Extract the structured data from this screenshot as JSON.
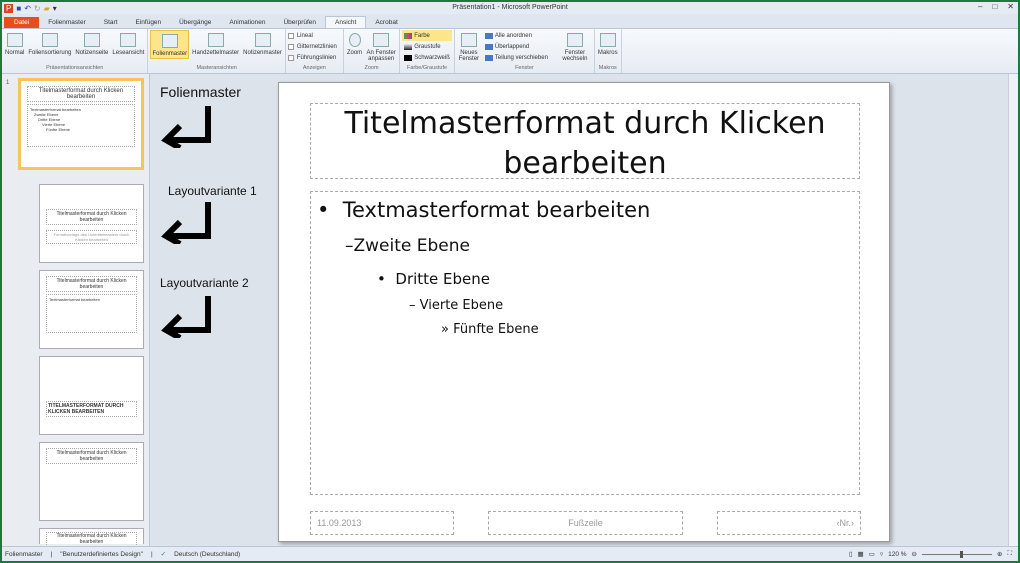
{
  "window": {
    "title": "Präsentation1 - Microsoft PowerPoint"
  },
  "qat": [
    "powerpoint-logo",
    "save-icon",
    "undo-icon",
    "redo-icon",
    "open-icon",
    "customize-icon"
  ],
  "tabs": [
    "Datei",
    "Folienmaster",
    "Start",
    "Einfügen",
    "Übergänge",
    "Animationen",
    "Überprüfen",
    "Ansicht",
    "Acrobat"
  ],
  "ribbon": {
    "praes": {
      "label": "Präsentationsansichten",
      "items": [
        "Normal",
        "Foliensortierung",
        "Notizenseite",
        "Leseansicht"
      ]
    },
    "master": {
      "label": "Masteransichten",
      "items": [
        "Folienmaster",
        "Handzettelmaster",
        "Notizenmaster"
      ]
    },
    "anzeigen": {
      "label": "Anzeigen",
      "items": [
        "Lineal",
        "Gitternetzlinien",
        "Führungslinien"
      ]
    },
    "zoom": {
      "label": "Zoom",
      "items": [
        "Zoom",
        "An Fenster anpassen"
      ]
    },
    "farbe": {
      "label": "Farbe/Graustufe",
      "items": [
        "Farbe",
        "Graustufe",
        "Schwarzweiß"
      ]
    },
    "fenster": {
      "label": "Fenster",
      "neues": "Neues Fenster",
      "items": [
        "Alle anordnen",
        "Überlappend",
        "Teilung verschieben"
      ],
      "wechseln": "Fenster wechseln"
    },
    "makros": {
      "label": "Makros",
      "items": [
        "Makros"
      ]
    }
  },
  "thumbs": {
    "num": "1",
    "master_title": "Titelmasterformat durch Klicken bearbeiten",
    "master_body": [
      "Textmasterformat bearbeiten",
      "Zweite Ebene",
      "Dritte Ebene",
      "Vierte Ebene",
      "Fünfte Ebene"
    ],
    "layout1_sub": "Formatvorlage des Untertitelmasters durch Klicken bearbeiten",
    "layout3_title": "TITELMASTERFORMAT DURCH KLICKEN BEARBEITEN"
  },
  "annotations": [
    "Folienmaster",
    "Layoutvariante 1",
    "Layoutvariante 2"
  ],
  "slide": {
    "title": "Titelmasterformat durch Klicken bearbeiten",
    "levels": [
      "Textmasterformat bearbeiten",
      "Zweite Ebene",
      "Dritte Ebene",
      "Vierte Ebene",
      "Fünfte Ebene"
    ],
    "bullets": [
      "•",
      "–",
      "•",
      "–",
      "»"
    ],
    "date": "11.09.2013",
    "footer": "Fußzeile",
    "number": "‹Nr.›"
  },
  "status": {
    "view": "Folienmaster",
    "theme": "\"Benutzerdefiniertes Design\"",
    "language": "Deutsch (Deutschland)",
    "zoom": "120 %"
  }
}
